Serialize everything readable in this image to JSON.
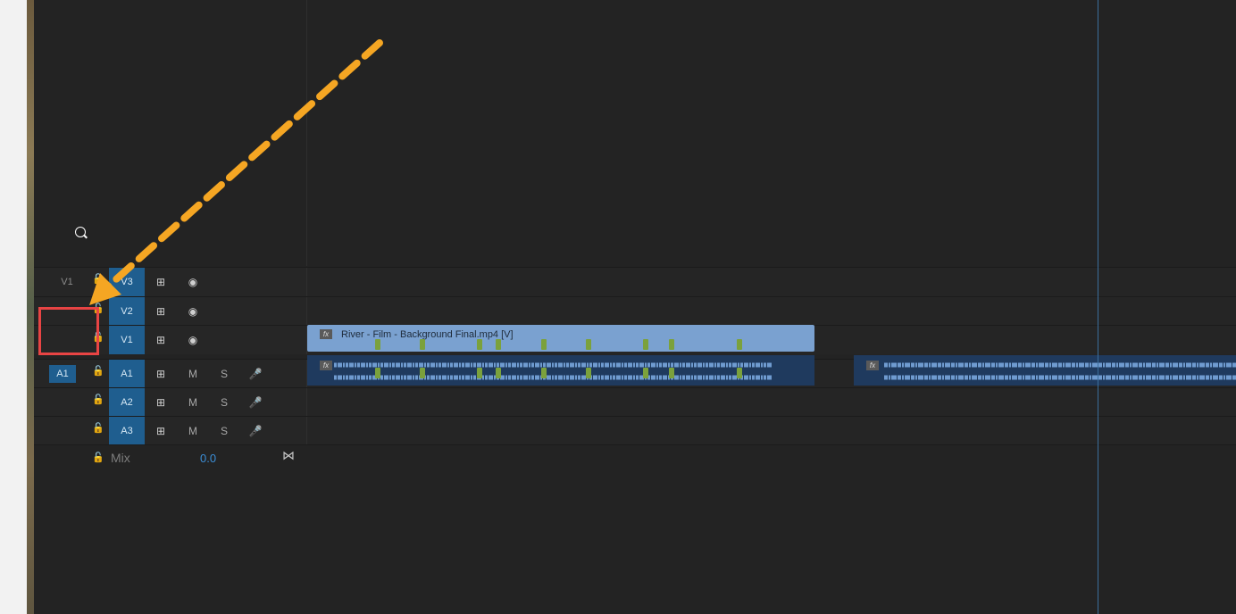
{
  "tracks": {
    "video": [
      {
        "source": "V1",
        "source_active": false,
        "name": "V3"
      },
      {
        "source": "",
        "source_active": false,
        "name": "V2"
      },
      {
        "source": "",
        "source_active": false,
        "name": "V1"
      }
    ],
    "audio": [
      {
        "source": "A1",
        "source_active": true,
        "name": "A1",
        "mute": "M",
        "solo": "S"
      },
      {
        "source": "",
        "source_active": false,
        "name": "A2",
        "mute": "M",
        "solo": "S"
      },
      {
        "source": "",
        "source_active": false,
        "name": "A3",
        "mute": "M",
        "solo": "S"
      }
    ],
    "mix": {
      "label": "Mix",
      "value": "0.0"
    }
  },
  "clips": {
    "video_clip": {
      "label": "River - Film - Background Final.mp4 [V]",
      "fx": "fx"
    },
    "audio_clip_1": {
      "fx": "fx"
    },
    "audio_clip_2": {
      "fx": "fx"
    }
  },
  "colors": {
    "track_target_active": "#1f5e8f",
    "video_clip": "#7aa1d0",
    "audio_clip": "#1f3a5e",
    "marker": "#7ba13c",
    "annotation_arrow": "#f5a623",
    "annotation_box": "#e84444"
  },
  "icons": {
    "lock": "lock-icon",
    "sync": "sync-lock-icon",
    "eye": "eye-icon",
    "mic": "mic-icon",
    "mix_toggle": "bowtie-icon"
  }
}
